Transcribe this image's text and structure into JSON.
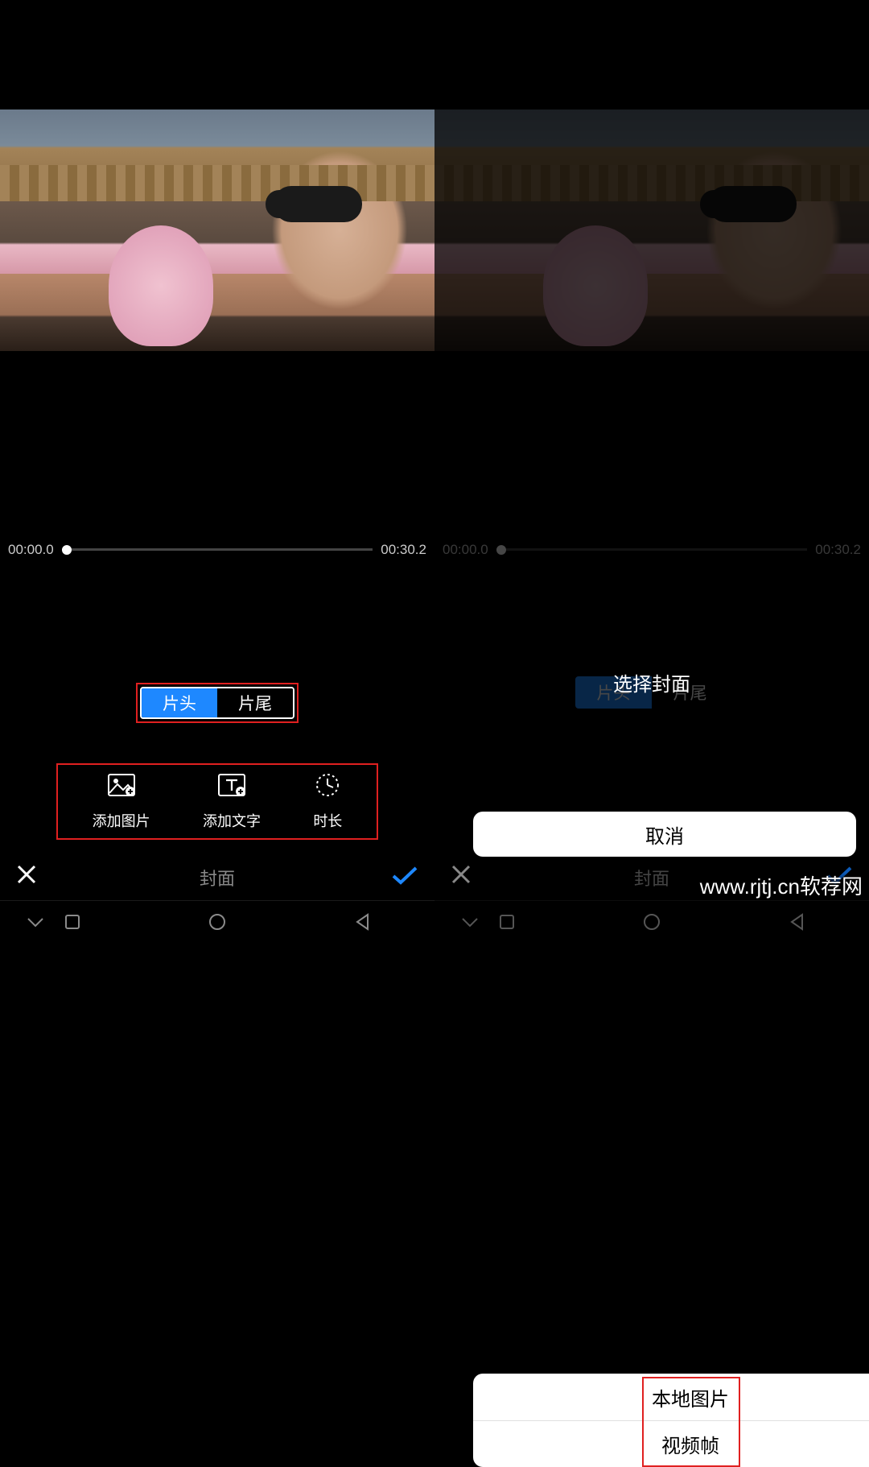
{
  "timeline": {
    "start": "00:00.0",
    "end": "00:30.2"
  },
  "segmented": {
    "head": "片头",
    "tail": "片尾"
  },
  "tools": {
    "add_image": "添加图片",
    "add_text": "添加文字",
    "duration": "时长"
  },
  "bottom": {
    "title": "封面"
  },
  "modal": {
    "title": "选择封面",
    "options": {
      "local_image": "本地图片",
      "video_frame": "视频帧"
    },
    "cancel": "取消"
  },
  "icons": {
    "image_add": "image-add-icon",
    "text_add": "text-add-icon",
    "clock": "clock-icon",
    "close": "close-icon",
    "check": "check-icon",
    "nav_back": "nav-back-icon",
    "nav_home": "nav-home-icon",
    "nav_recent": "nav-recent-icon",
    "nav_down": "nav-down-icon"
  },
  "watermark": "www.rjtj.cn软荐网"
}
